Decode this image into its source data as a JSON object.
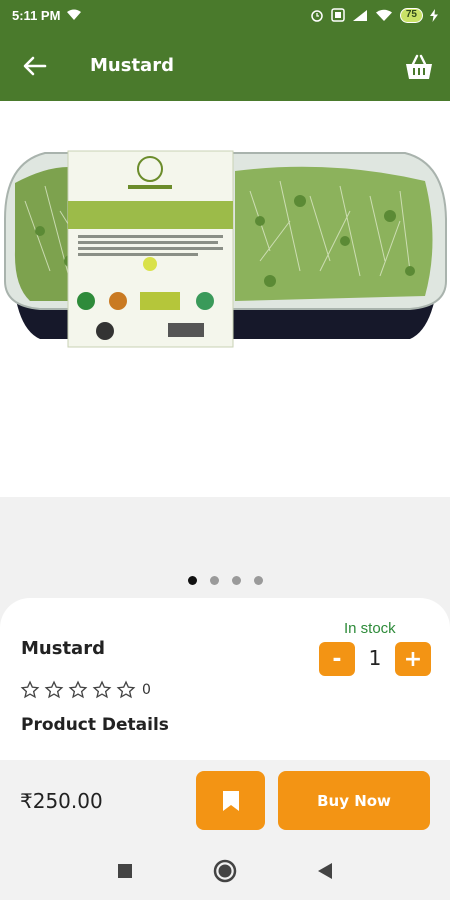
{
  "status_bar": {
    "time": "5:11 PM",
    "battery": "75"
  },
  "app_bar": {
    "title": "Mustard",
    "back_icon": "arrow-left-icon",
    "cart_icon": "basket-icon"
  },
  "gallery": {
    "image_description_icon": "product-photo",
    "dots_total": 4,
    "active_dot": 0
  },
  "product": {
    "name": "Mustard",
    "stock_status": "In stock",
    "quantity": "1",
    "minus_label": "-",
    "plus_label": "+",
    "rating_count": "0",
    "rating_value": 0,
    "rating_max": 5,
    "details_heading": "Product Details"
  },
  "bottom": {
    "price": "₹250.00",
    "buy_label": "Buy Now",
    "bookmark_icon": "bookmark-icon"
  },
  "colors": {
    "primary_green": "#4a7a2c",
    "accent_orange": "#f39414",
    "stock_green": "#2e8b3a"
  }
}
